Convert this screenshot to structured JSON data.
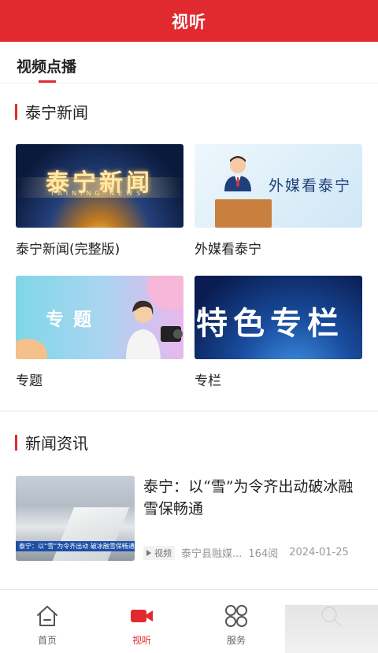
{
  "header": {
    "title": "视听"
  },
  "subtabs": [
    {
      "label": "视频点播"
    }
  ],
  "sections": [
    {
      "title": "泰宁新闻",
      "cards": [
        {
          "label": "泰宁新闻(完整版)",
          "thumb_text": "泰宁新闻",
          "thumb_sub": "TAINING NEWS"
        },
        {
          "label": "外媒看泰宁",
          "thumb_text": "外媒看泰宁"
        },
        {
          "label": "专题",
          "thumb_text": "专题"
        },
        {
          "label": "专栏",
          "thumb_text": "特色专栏"
        }
      ]
    },
    {
      "title": "新闻资讯",
      "news": [
        {
          "title": "泰宁：以“雪”为令齐出动破冰融雪保畅通",
          "thumb_caption": "泰宁：以“雪”为令齐出动 破冰融雪保畅通",
          "tag": "视频",
          "source": "泰宁县融媒...",
          "views": "164阅",
          "date": "2024-01-25"
        }
      ]
    }
  ],
  "tabbar": [
    {
      "label": "首页",
      "icon": "home-icon"
    },
    {
      "label": "视听",
      "icon": "video-camera-icon",
      "active": true
    },
    {
      "label": "服务",
      "icon": "grid-icon"
    },
    {
      "label": "",
      "icon": "search-icon"
    }
  ],
  "colors": {
    "accent": "#e12a2f",
    "text": "#222222",
    "muted": "#999999"
  }
}
